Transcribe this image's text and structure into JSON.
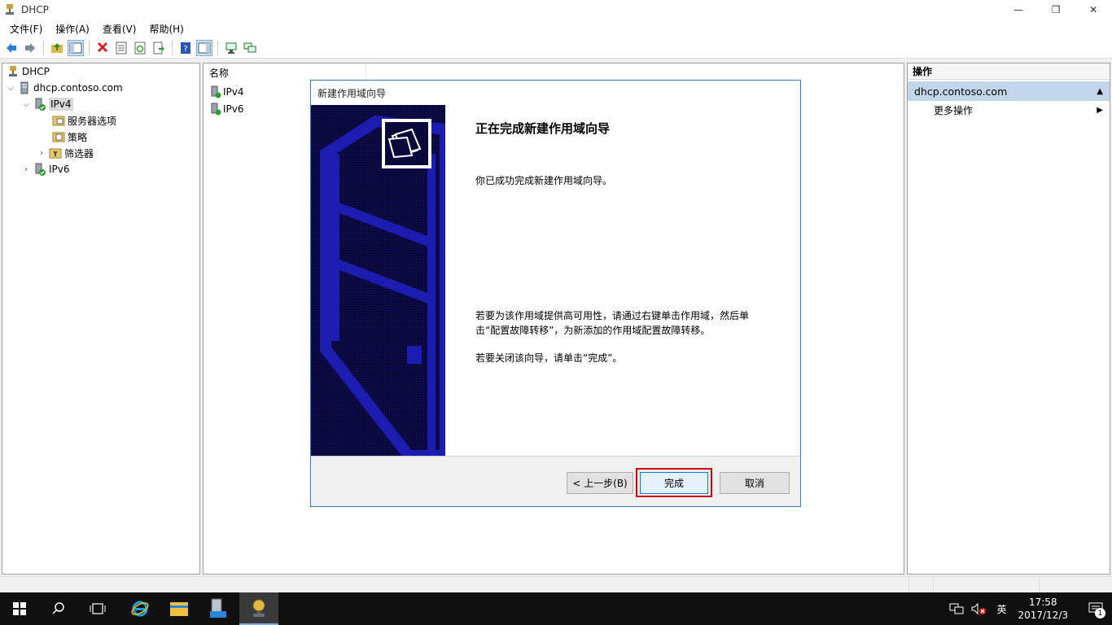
{
  "window": {
    "title": "DHCP",
    "controls": {
      "minimize": "—",
      "restore": "❐",
      "close": "✕"
    }
  },
  "menu": [
    "文件(F)",
    "操作(A)",
    "查看(V)",
    "帮助(H)"
  ],
  "tree": {
    "root": "DHCP",
    "server": "dhcp.contoso.com",
    "ipv4": "IPv4",
    "server_options": "服务器选项",
    "policies": "策略",
    "filters": "筛选器",
    "ipv6": "IPv6"
  },
  "list": {
    "header": "名称",
    "rows": [
      "IPv4",
      "IPv6"
    ]
  },
  "actions": {
    "header": "操作",
    "section": "dhcp.contoso.com",
    "item": "更多操作"
  },
  "wizard": {
    "title": "新建作用域向导",
    "heading": "正在完成新建作用域向导",
    "p1": "你已成功完成新建作用域向导。",
    "p2": "若要为该作用域提供高可用性，请通过右键单击作用域，然后单击“配置故障转移”，为新添加的作用域配置故障转移。",
    "p3": "若要关闭该向导，请单击“完成”。",
    "back_button": "< 上一步(B)",
    "finish_button": "完成",
    "cancel_button": "取消"
  },
  "taskbar": {
    "ime": "英",
    "time": "17:58",
    "date": "2017/12/3",
    "notification_count": "1"
  },
  "colors": {
    "banner": "#08083a",
    "accent": "#0078d7",
    "highlight": "#d40000",
    "action_section": "#c3d5e8"
  }
}
